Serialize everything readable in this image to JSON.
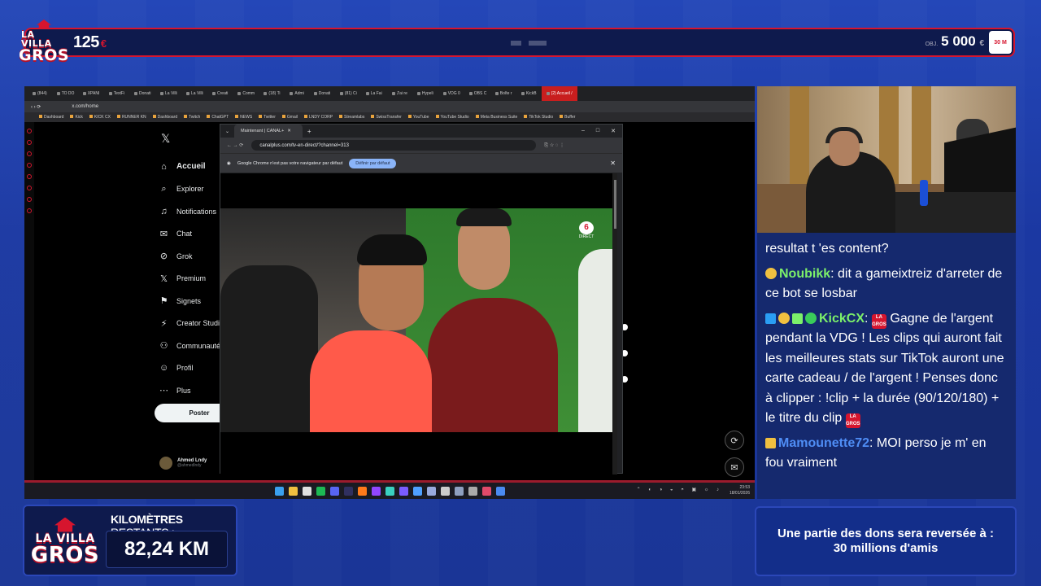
{
  "overlay": {
    "logo": {
      "line1": "LA VILLA",
      "line2": "GROS"
    },
    "counter": {
      "value": "125",
      "unit": "€"
    },
    "goal": {
      "prefix": "OBJ.",
      "value": "5 000",
      "unit": "€"
    },
    "km": {
      "label_bold": "KILOMÈTRES",
      "label_rest": " RESTANTS :",
      "value": "82,24 KM"
    },
    "donation_note": {
      "line1": "Une partie des dons sera reversée à :",
      "line2": "30 millions d'amis"
    },
    "colors": {
      "accent_red": "#d6152e",
      "bar_bg": "#0e1a4d",
      "chat_bg": "#15296e"
    }
  },
  "browser": {
    "tabs": [
      "(844)",
      "TO DO",
      "XPANI",
      "TextFi",
      "Donati",
      "La Villi",
      "La Villi",
      "Creati",
      "Comm",
      "(18) Ti",
      "Admi",
      "Donati",
      "(81) Ci",
      "La Fai",
      "J'ai re",
      "Hypeli",
      "VDG 0",
      "OBS C",
      "Boîte r",
      "KickB",
      "(2) Accueil /"
    ],
    "address": "x.com/home",
    "bookmarks": [
      "Dashboard",
      "Kick",
      "KICK CX",
      "RUNNER KN",
      "Dashboard",
      "Twitch",
      "ChatGPT",
      "NEWS",
      "Twitter",
      "Gmail",
      "LNDY CORP",
      "Streamlabs",
      "SwissTransfer",
      "YouTube",
      "YouTube Studio",
      "Meta Business Suite",
      "TikTok Studio",
      "Buffer"
    ]
  },
  "x_sidebar": {
    "logo": "𝕏",
    "items": [
      {
        "icon": "home-icon",
        "glyph": "⌂",
        "label": "Accueil"
      },
      {
        "icon": "search-icon",
        "glyph": "⌕",
        "label": "Explorer"
      },
      {
        "icon": "bell-icon",
        "glyph": "♫",
        "label": "Notifications"
      },
      {
        "icon": "chat-icon",
        "glyph": "✉",
        "label": "Chat"
      },
      {
        "icon": "grok-icon",
        "glyph": "⊘",
        "label": "Grok"
      },
      {
        "icon": "x-premium-icon",
        "glyph": "𝕏",
        "label": "Premium"
      },
      {
        "icon": "bookmark-icon",
        "glyph": "⚑",
        "label": "Signets"
      },
      {
        "icon": "bolt-icon",
        "glyph": "⚡",
        "label": "Creator Studio"
      },
      {
        "icon": "community-icon",
        "glyph": "⚇",
        "label": "Communautés"
      },
      {
        "icon": "profile-icon",
        "glyph": "☺",
        "label": "Profil"
      },
      {
        "icon": "more-icon",
        "glyph": "⋯",
        "label": "Plus"
      }
    ],
    "post_button": "Poster",
    "user": {
      "name": "Ahmed Lndy",
      "handle": "@ahmedlndy"
    }
  },
  "popup": {
    "tab_title": "Maintenant | CANAL+",
    "url": "canalplus.com/tv-en-direct/?channel=313",
    "info_text": "Google Chrome n'est pas votre navigateur par défaut",
    "info_button": "Définir par défaut",
    "channel_label": "DIRECT",
    "channel_logo": "6"
  },
  "taskbar": {
    "time": "23:53",
    "date": "18/01/2026"
  },
  "chat": [
    {
      "user": "",
      "text": "resultat t 'es content?"
    },
    {
      "user": "Noubikk",
      "user_color": "#7cf06a",
      "text": ": dit a gameixtreiz d'arreter de ce bot se losbar"
    },
    {
      "user": "KickCX",
      "user_color": "#7cf06a",
      "text_a": ": ",
      "text_b": " Gagne de l'argent pendant la VDG ! Les clips qui auront fait les meilleures stats sur TikTok auront une carte cadeau / de l'argent ! Penses donc à clipper : !clip + la durée (90/120/180) + le titre du clip "
    },
    {
      "user": "Mamounette72",
      "user_color": "#4f8df5",
      "text": ": MOI perso je m' en fou vraiment"
    }
  ]
}
